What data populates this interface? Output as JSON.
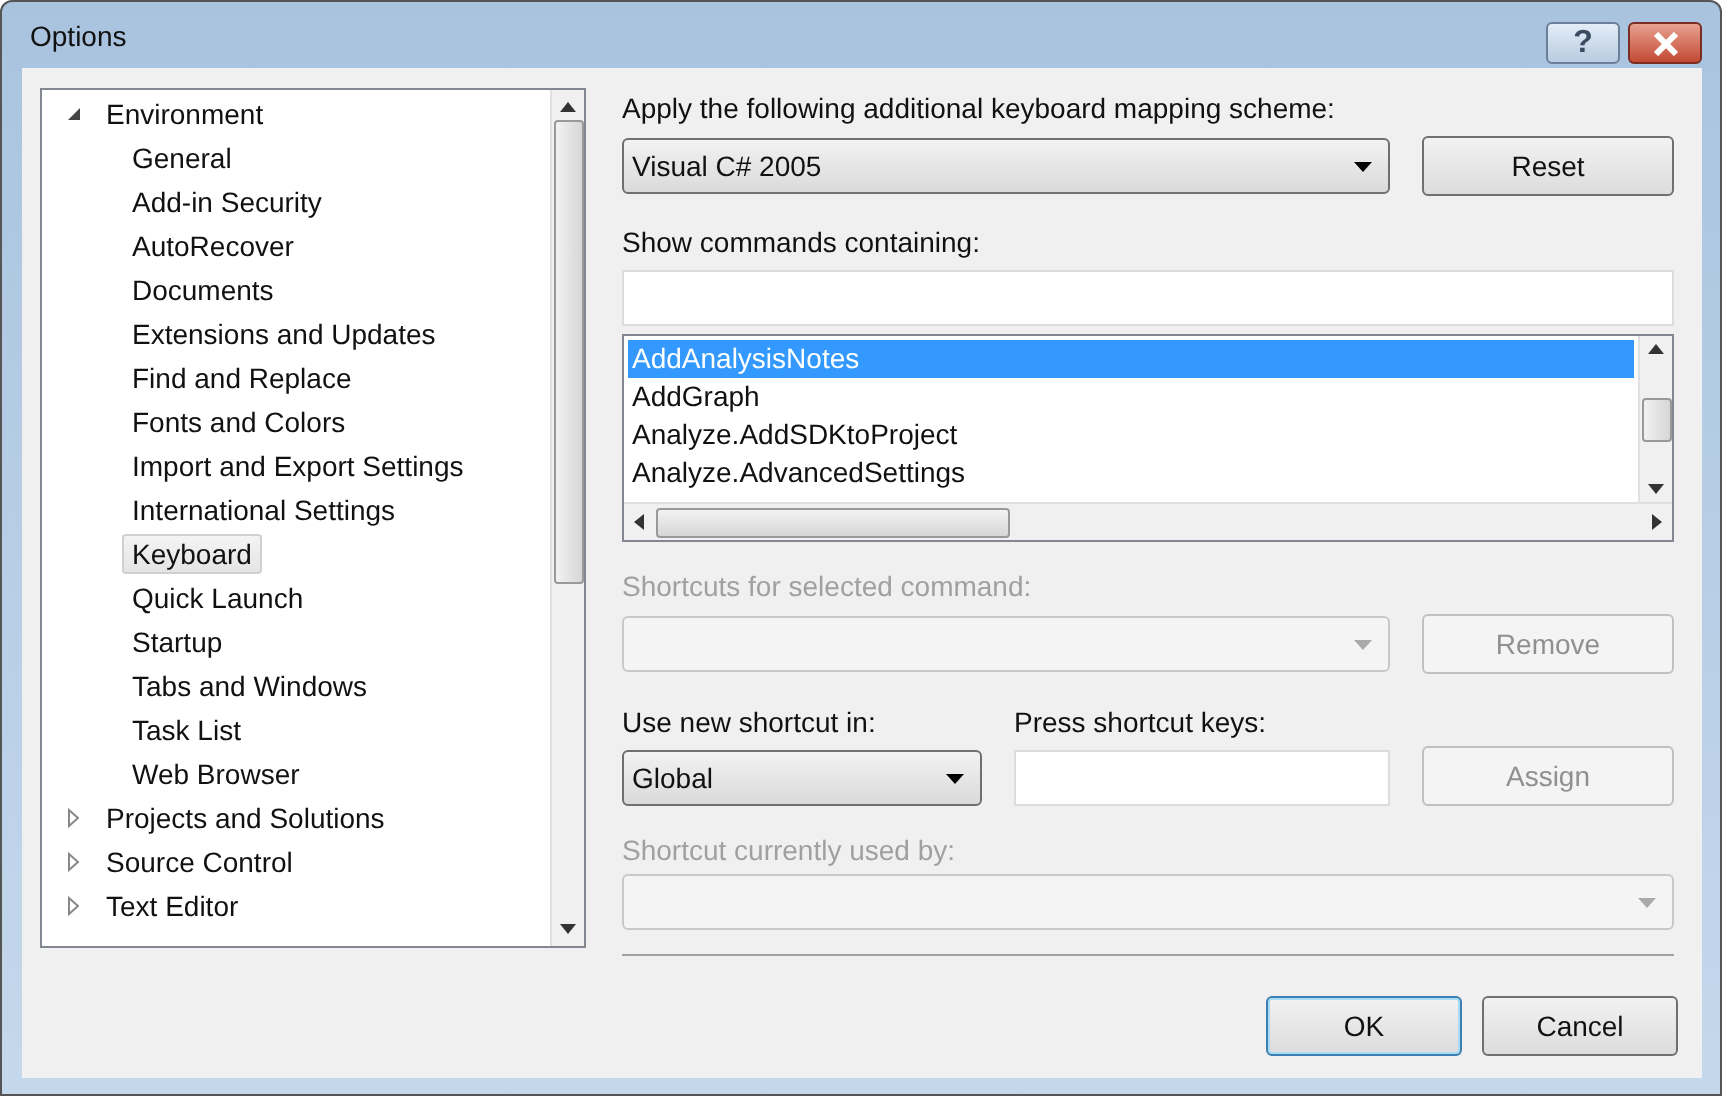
{
  "window": {
    "title": "Options",
    "help_button": "?"
  },
  "tree": [
    {
      "label": "Environment",
      "expanded": true,
      "selected": false,
      "children": [
        {
          "label": "General",
          "selected": false
        },
        {
          "label": "Add-in Security",
          "selected": false
        },
        {
          "label": "AutoRecover",
          "selected": false
        },
        {
          "label": "Documents",
          "selected": false
        },
        {
          "label": "Extensions and Updates",
          "selected": false
        },
        {
          "label": "Find and Replace",
          "selected": false
        },
        {
          "label": "Fonts and Colors",
          "selected": false
        },
        {
          "label": "Import and Export Settings",
          "selected": false
        },
        {
          "label": "International Settings",
          "selected": false
        },
        {
          "label": "Keyboard",
          "selected": true
        },
        {
          "label": "Quick Launch",
          "selected": false
        },
        {
          "label": "Startup",
          "selected": false
        },
        {
          "label": "Tabs and Windows",
          "selected": false
        },
        {
          "label": "Task List",
          "selected": false
        },
        {
          "label": "Web Browser",
          "selected": false
        }
      ]
    },
    {
      "label": "Projects and Solutions",
      "expanded": false,
      "selected": false
    },
    {
      "label": "Source Control",
      "expanded": false,
      "selected": false
    },
    {
      "label": "Text Editor",
      "expanded": false,
      "selected": false
    }
  ],
  "mapping": {
    "label": "Apply the following additional keyboard mapping scheme:",
    "value": "Visual C# 2005",
    "button": "Reset"
  },
  "commands": {
    "label": "Show commands containing:",
    "items": [
      {
        "label": "AddAnalysisNotes",
        "selected": true
      },
      {
        "label": "AddGraph",
        "selected": false
      },
      {
        "label": "Analyze.AddSDKtoProject",
        "selected": false
      },
      {
        "label": "Analyze.AdvancedSettings",
        "selected": false
      }
    ]
  },
  "shortcuts": {
    "label": "Shortcuts for selected command:",
    "disabled": true,
    "button": "Remove"
  },
  "use_in": {
    "label": "Use new shortcut in:",
    "value": "Global"
  },
  "press_keys": {
    "label": "Press shortcut keys:",
    "button": "Assign",
    "button_disabled": true
  },
  "used_by": {
    "label": "Shortcut currently used by:",
    "disabled": true
  },
  "buttons": [
    {
      "label": "OK",
      "default": true
    },
    {
      "label": "Cancel",
      "default": false
    }
  ]
}
